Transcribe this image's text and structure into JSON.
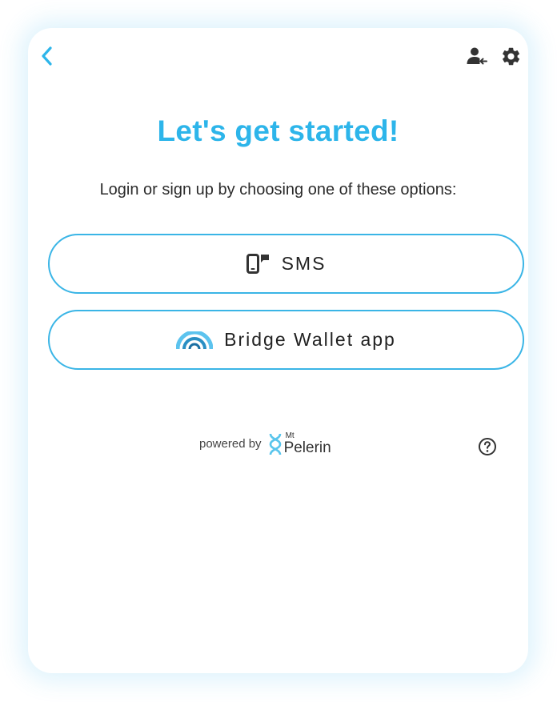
{
  "header": {
    "back_icon": "chevron-left-icon",
    "login_icon": "person-login-icon",
    "settings_icon": "gear-icon"
  },
  "main": {
    "title": "Let's get started!",
    "subtitle": "Login or sign up by choosing one of these options:",
    "options": [
      {
        "label": "SMS",
        "icon": "phone-message-icon"
      },
      {
        "label": "Bridge Wallet app",
        "icon": "bridge-wallet-logo-icon"
      }
    ]
  },
  "footer": {
    "powered_by": "powered by",
    "brand_mt": "Mt",
    "brand_name": "Pelerin",
    "help_icon": "help-circle-icon"
  },
  "colors": {
    "accent": "#2db5ea",
    "border": "#3ab5e6",
    "text": "#222222",
    "icon": "#333333"
  }
}
